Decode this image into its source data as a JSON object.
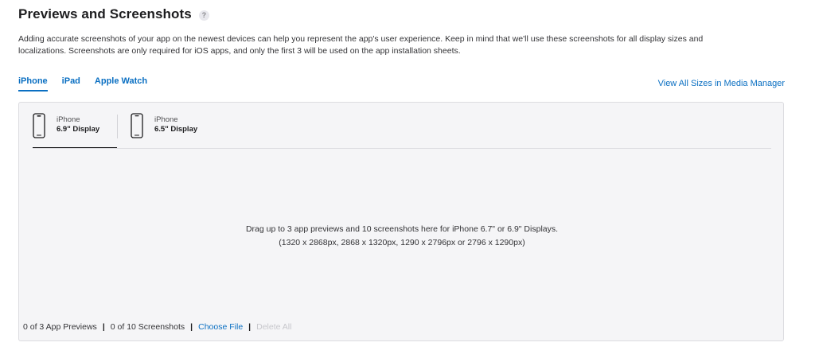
{
  "header": {
    "title": "Previews and Screenshots",
    "help_glyph": "?",
    "help_icon": "question-circle-icon"
  },
  "description": {
    "line1": "Adding accurate screenshots of your app on the newest devices can help you represent the app's user experience. Keep in mind that we'll use these screenshots for all display sizes and",
    "line2": "localizations. Screenshots are only required for iOS apps, and only the first 3 will be used on the app installation sheets."
  },
  "device_tabs": [
    {
      "label": "iPhone",
      "active": true
    },
    {
      "label": "iPad",
      "active": false
    },
    {
      "label": "Apple Watch",
      "active": false
    }
  ],
  "media_manager_link": "View All Sizes in Media Manager",
  "size_tabs": [
    {
      "device": "iPhone",
      "size": "6.9\" Display",
      "icon": "iphone-icon",
      "active": true
    },
    {
      "device": "iPhone",
      "size": "6.5\" Display",
      "icon": "iphone-icon",
      "active": false
    }
  ],
  "drop_zone": {
    "line1": "Drag up to 3 app previews and 10 screenshots here for iPhone 6.7\" or 6.9\" Displays.",
    "line2": "(1320 x 2868px, 2868 x 1320px, 1290 x 2796px or 2796 x 1290px)"
  },
  "footer": {
    "previews_count": "0 of 3 App Previews",
    "screenshots_count": "0 of 10 Screenshots",
    "separator": "|",
    "choose_file": "Choose File",
    "delete_all": "Delete All"
  },
  "colors": {
    "accent": "#0a6fc2",
    "panel_bg": "#f5f5f7",
    "disabled_text": "#c7c7cc"
  }
}
